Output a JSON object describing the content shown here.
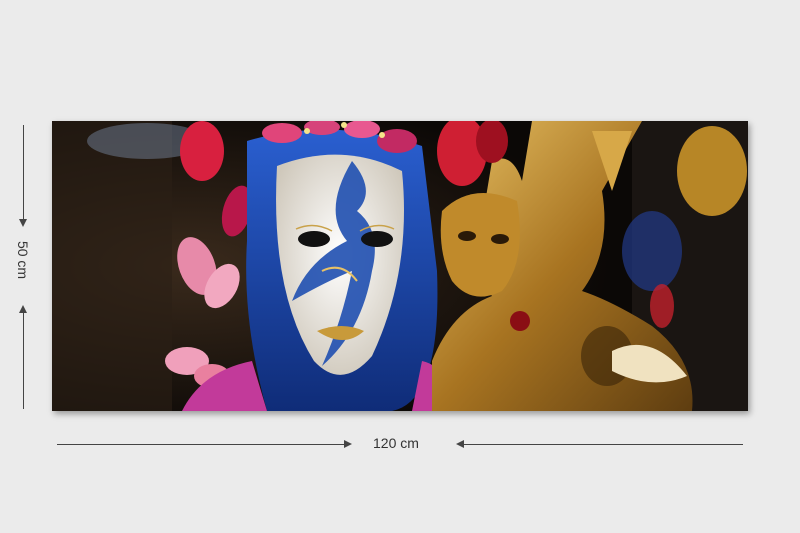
{
  "dimensions": {
    "width_label": "120 cm",
    "height_label": "50 cm"
  },
  "artwork": {
    "subject": "venetian-carnival-masks",
    "colors": {
      "background": "#ebebeb",
      "mask_blue": "#1f4fb0",
      "mask_white": "#f2efe9",
      "gold": "#b8862a",
      "pink": "#d6437a"
    }
  }
}
